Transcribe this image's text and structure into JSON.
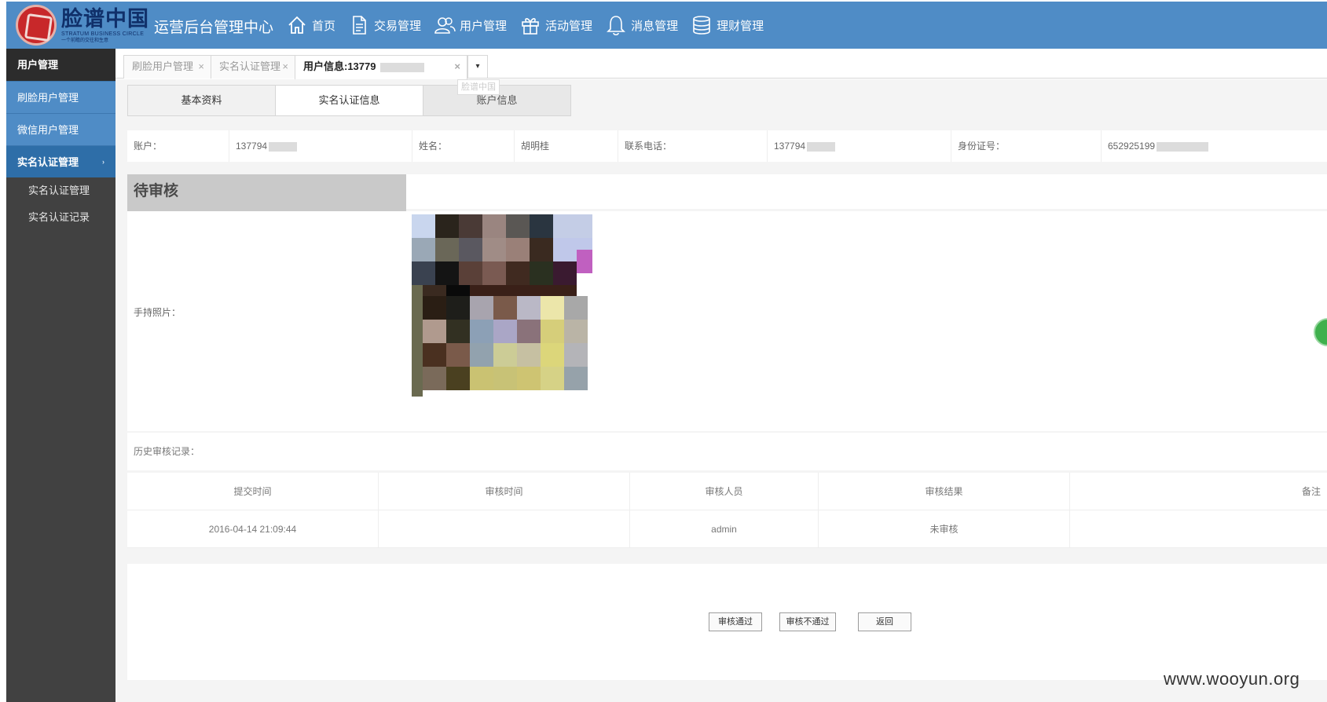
{
  "header": {
    "logo_text": "脸谱中国",
    "logo_sub": "STRATUM BUSINESS CIRCLE",
    "logo_sub2": "一个前瞻的交往和生意",
    "app_title": "运营后台管理中心",
    "nav": [
      {
        "label": "首页",
        "icon": "home-icon"
      },
      {
        "label": "交易管理",
        "icon": "document-icon"
      },
      {
        "label": "用户管理",
        "icon": "users-icon"
      },
      {
        "label": "活动管理",
        "icon": "gift-icon"
      },
      {
        "label": "消息管理",
        "icon": "bell-icon"
      },
      {
        "label": "理财管理",
        "icon": "database-icon"
      }
    ]
  },
  "sidebar": {
    "heading": "用户管理",
    "items": [
      {
        "label": "刷脸用户管理"
      },
      {
        "label": "微信用户管理"
      },
      {
        "label": "实名认证管理",
        "arrow": "›"
      }
    ],
    "sub_items": [
      {
        "label": "实名认证管理"
      },
      {
        "label": "实名认证记录"
      }
    ]
  },
  "tabs": [
    {
      "label": "刷脸用户管理",
      "close": "×"
    },
    {
      "label": "实名认证管理",
      "close": "×"
    },
    {
      "label": "用户信息:13779",
      "close": "×"
    }
  ],
  "tab_dropdown": "▾",
  "tooltip": "脸谱中国",
  "subtabs": [
    {
      "label": "基本资料"
    },
    {
      "label": "实名认证信息"
    },
    {
      "label": "账户信息"
    }
  ],
  "info": {
    "account_label": "账户：",
    "account_value": "137794",
    "name_label": "姓名：",
    "name_value": "胡明桂",
    "phone_label": "联系电话：",
    "phone_value": "137794",
    "id_label": "身份证号：",
    "id_value": "652925199"
  },
  "pending_label": "待审核",
  "photo_label": "手持照片：",
  "history_label": "历史审核记录：",
  "table": {
    "headers": [
      "提交时间",
      "审核时间",
      "审核人员",
      "审核结果",
      "备注"
    ],
    "rows": [
      [
        "2016-04-14 21:09:44",
        "",
        "admin",
        "未审核",
        ""
      ]
    ]
  },
  "actions": [
    "审核通过",
    "审核不通过",
    "返回"
  ],
  "watermark": "www.wooyun.org",
  "colors": {
    "header_bg": "#4f8cc6",
    "sidebar_bg": "#414141",
    "sidebar_item_bg": "#4f8cc6",
    "logo_red": "#c8282a"
  }
}
